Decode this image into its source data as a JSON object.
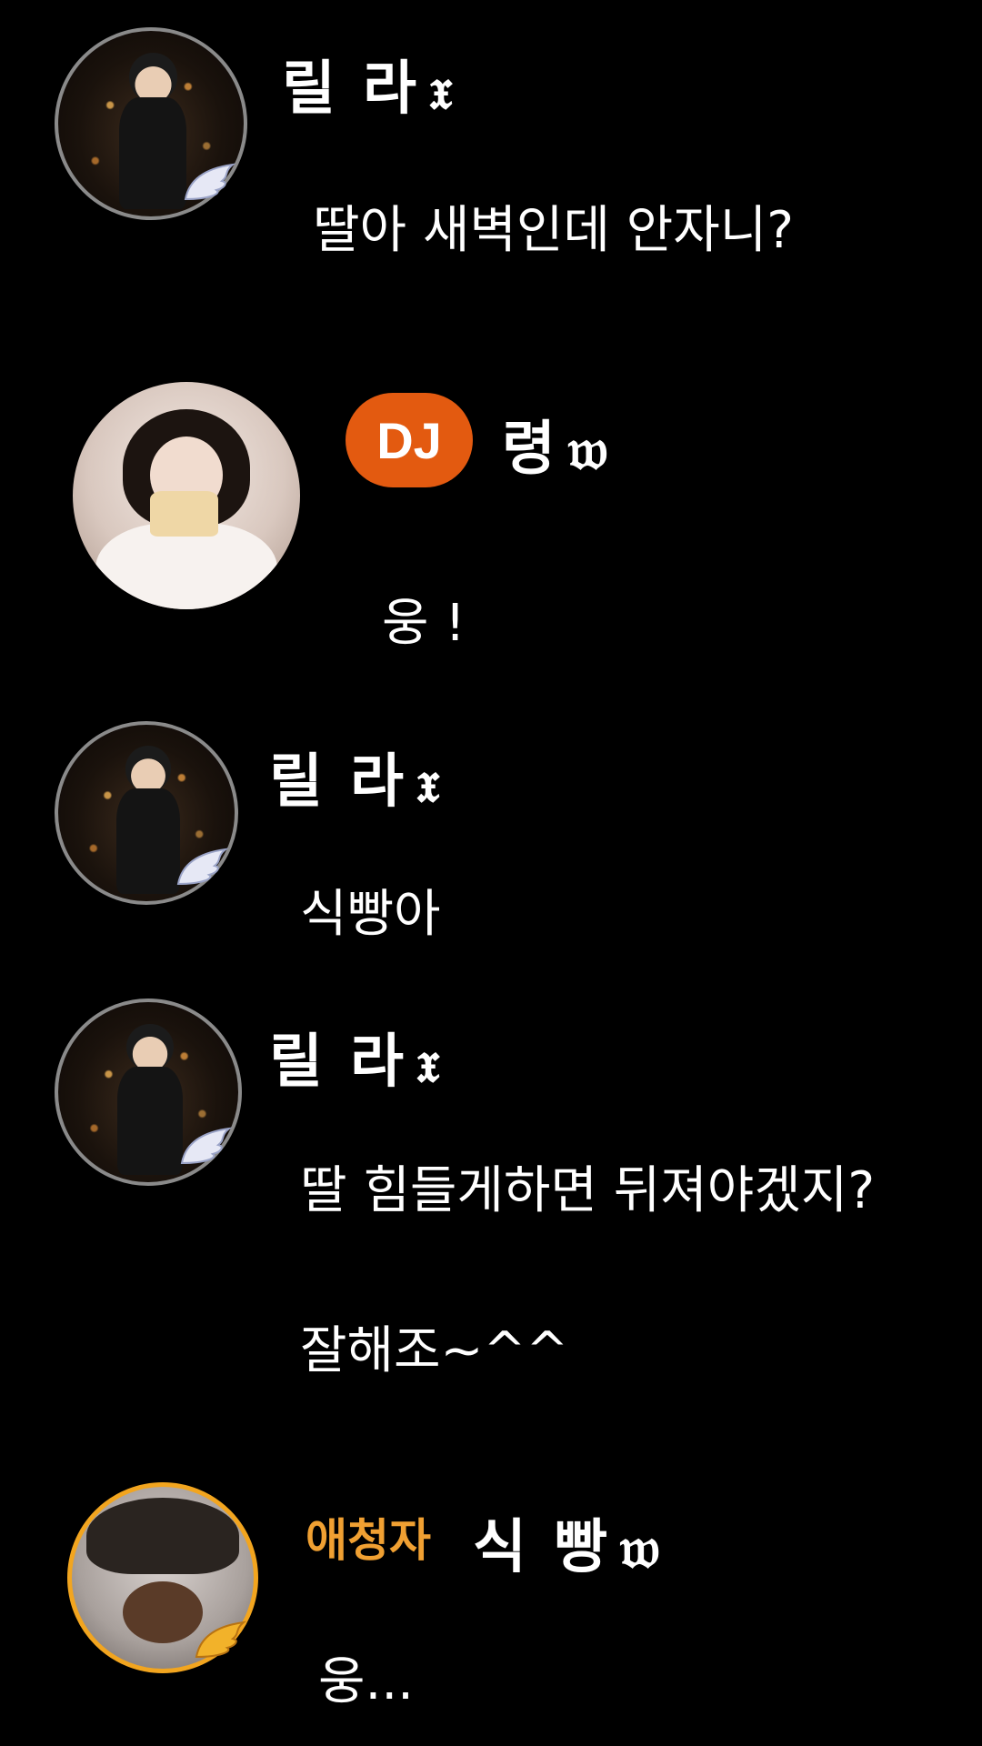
{
  "messages": [
    {
      "user": {
        "name": "릴 라",
        "icon": "𝔵"
      },
      "avatar": "character-avatar",
      "texts": [
        "딸아 새벽인데 안자니?"
      ]
    },
    {
      "user": {
        "badge": "DJ",
        "name": "령",
        "icon": "𝔴"
      },
      "avatar": "girl-bread-avatar",
      "texts": [
        "웅 !"
      ]
    },
    {
      "user": {
        "name": "릴 라",
        "icon": "𝔵"
      },
      "avatar": "character-avatar",
      "texts": [
        "식빵아"
      ]
    },
    {
      "user": {
        "name": "릴 라",
        "icon": "𝔵"
      },
      "avatar": "character-avatar",
      "texts": [
        "딸 힘들게하면 뒤져야겠지?",
        "잘해조~^^"
      ]
    },
    {
      "user": {
        "label": "애청자",
        "name": "식 빵",
        "icon": "𝔴"
      },
      "avatar": "listener-avatar",
      "texts": [
        "웅..."
      ]
    }
  ],
  "colors": {
    "background": "#000000",
    "dj_badge": "#e35a10",
    "listener": "#f0a032",
    "listener_ring": "#f2a51f"
  }
}
